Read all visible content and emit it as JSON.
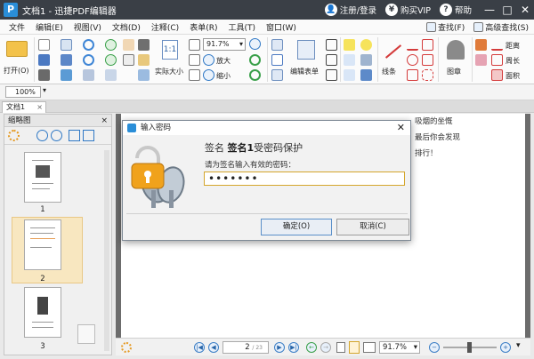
{
  "app": {
    "title": "文档1 - 迅捷PDF编辑器",
    "logo": "P",
    "header_links": [
      {
        "label": "注册/登录",
        "icon": "user-icon"
      },
      {
        "label": "购买VIP",
        "icon": "yen-icon"
      },
      {
        "label": "帮助",
        "icon": "question-icon"
      }
    ],
    "window_controls": [
      "—",
      "□",
      "✕"
    ]
  },
  "menu": {
    "items": [
      "文件",
      "编辑(E)",
      "视图(V)",
      "文档(D)",
      "注释(C)",
      "表单(R)",
      "工具(T)",
      "窗口(W)"
    ],
    "search_label": "查找(F)",
    "advanced_search_label": "高级查找(S)"
  },
  "ribbon": {
    "open_label": "打开(O)",
    "actual_size_label": "实际大小",
    "zoom_value": "91.7%",
    "zoom_in_label": "放大",
    "zoom_out_label": "缩小",
    "edit_form_label": "编辑表单",
    "line_label": "线条",
    "stamp_label": "图章",
    "distance_label": "距离",
    "perimeter_label": "周长",
    "area_label": "面积"
  },
  "zoom_row": {
    "value": "100%"
  },
  "tab": {
    "label": "文档1",
    "close": "×"
  },
  "thumbs": {
    "title": "缩略图",
    "close": "×",
    "pages": [
      "1",
      "2",
      "3"
    ],
    "selected_index": 1
  },
  "document": {
    "fragments": [
      "吸烟的坐慨",
      "最后你会发现",
      "排行！"
    ]
  },
  "status": {
    "page_current": "2",
    "page_total": "/ 23",
    "zoom": "91.7%"
  },
  "dialog": {
    "title": "输入密码",
    "close": "✕",
    "heading_prefix": "签名",
    "heading_bold": "签名1",
    "heading_suffix": "受密码保护",
    "prompt": "请为签名输入有效的密码：",
    "password_mask": "•••••••",
    "ok_label": "确定(O)",
    "cancel_label": "取消(C)"
  },
  "colors": {
    "titlebar": "#3a3f46",
    "accent_blue": "#2a8ed8",
    "lock_orange": "#f0a21c",
    "selection": "#f8e7c0"
  }
}
